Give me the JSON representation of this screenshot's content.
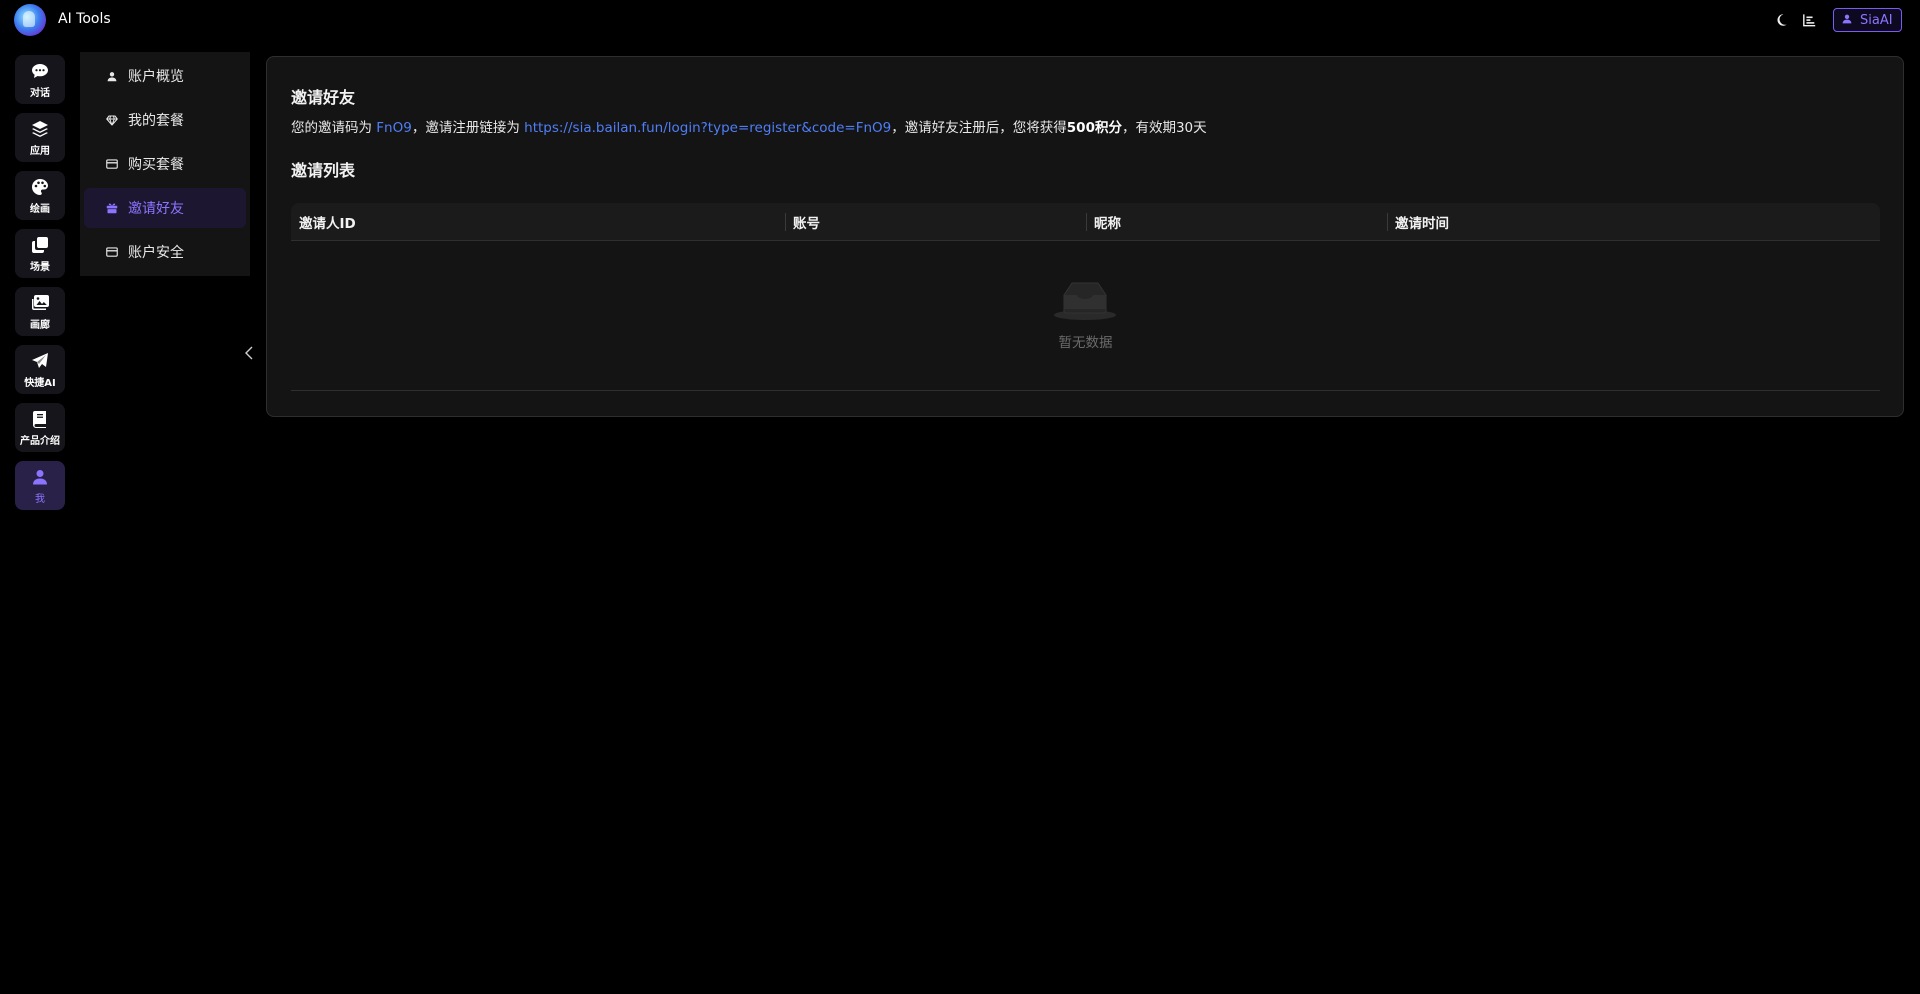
{
  "header": {
    "app_title": "AI Tools",
    "user_name": "SiaAI",
    "icons": [
      "logo-icon",
      "moon-icon",
      "chart-icon",
      "user-icon"
    ]
  },
  "rail": {
    "items": [
      {
        "label": "对话",
        "icon": "chat-icon"
      },
      {
        "label": "应用",
        "icon": "layers-icon"
      },
      {
        "label": "绘画",
        "icon": "palette-icon"
      },
      {
        "label": "场景",
        "icon": "clone-icon"
      },
      {
        "label": "画廊",
        "icon": "images-icon"
      },
      {
        "label": "快捷AI",
        "icon": "paper-plane-icon"
      },
      {
        "label": "产品介绍",
        "icon": "book-icon"
      },
      {
        "label": "我",
        "icon": "user-icon"
      }
    ],
    "active_index": 7
  },
  "subnav": {
    "items": [
      {
        "label": "账户概览",
        "icon": "user-icon"
      },
      {
        "label": "我的套餐",
        "icon": "diamond-icon"
      },
      {
        "label": "购买套餐",
        "icon": "card-icon"
      },
      {
        "label": "邀请好友",
        "icon": "gift-icon"
      },
      {
        "label": "账户安全",
        "icon": "card-icon"
      }
    ],
    "active_index": 3
  },
  "main": {
    "title": "邀请好友",
    "invite_prefix": "您的邀请码为 ",
    "invite_code": "FnO9",
    "invite_mid": "，邀请注册链接为 ",
    "invite_link": "https://sia.bailan.fun/login?type=register&code=FnO9",
    "invite_mid2": "，邀请好友注册后，您将获得",
    "invite_reward": "500积分",
    "invite_suffix": "，有效期30天",
    "list_title": "邀请列表",
    "table": {
      "columns": [
        "邀请人ID",
        "账号",
        "昵称",
        "邀请时间"
      ],
      "rows": [],
      "empty_text": "暂无数据"
    }
  },
  "colors": {
    "accent": "#8d74ff",
    "link": "#4f7ef7",
    "background": "#000000",
    "card": "#141414"
  }
}
